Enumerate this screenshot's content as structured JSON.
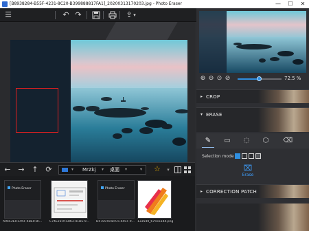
{
  "window": {
    "title": "[B8938284-B55F-4231-8C20-B399888817FA1]_20200313170203.jpg - Photo Eraser",
    "minimize_glyph": "—",
    "maximize_glyph": "☐",
    "close_glyph": "✕"
  },
  "toolbar": {
    "menu_icon": "☰",
    "undo_icon": "↶",
    "redo_icon": "↷",
    "save_icon": "💾",
    "print_icon": "⎙",
    "share_icon": "⇪",
    "share_chevron": "▾"
  },
  "browser": {
    "back_icon": "←",
    "forward_icon": "→",
    "up_icon": "↑",
    "refresh_icon": "⟳",
    "path": [
      "MrZkj",
      "桌面"
    ],
    "star_icon": "☆"
  },
  "thumbnails": [
    {
      "caption": "A94C2E0-E95F-4BE0-8F...",
      "kind": "app",
      "logo": "Photo Eraser"
    },
    {
      "caption": "C74E25FA-E863-41DE-9...",
      "kind": "doc"
    },
    {
      "caption": "D57E97B-BFC5-44CF-9...",
      "kind": "app",
      "logo": "Photo Eraser"
    },
    {
      "caption": "133540_67555144.png",
      "kind": "logo"
    }
  ],
  "zoom": {
    "value_label": "72.5 %",
    "fraction": 0.5
  },
  "panel": {
    "crop_label": "CROP",
    "erase_label": "ERASE",
    "selection_mode_label": "Selection mode",
    "erase_button_label": "Erase",
    "correction_patch_label": "CORRECTION PATCH",
    "expand_arrow": "▸",
    "collapse_arrow": "▾"
  },
  "colors": {
    "accent": "#2f8fe0",
    "selection_rect": "#e02020"
  }
}
